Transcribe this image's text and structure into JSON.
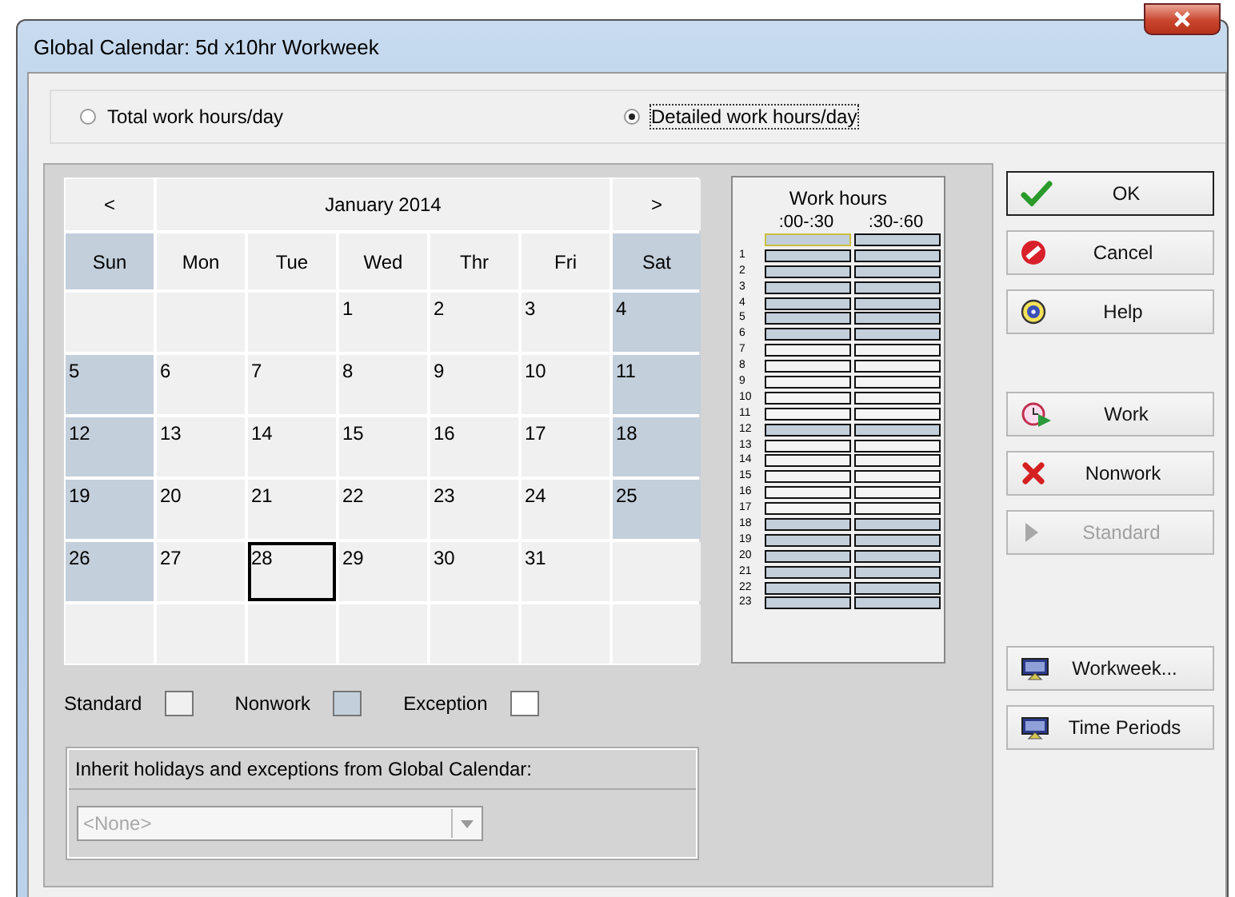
{
  "window": {
    "title": "Global Calendar: 5d x10hr Workweek"
  },
  "modes": [
    {
      "label": "Total work hours/day",
      "selected": false
    },
    {
      "label": "Detailed work hours/day",
      "selected": true
    }
  ],
  "calendar": {
    "prev": "<",
    "month": "January 2014",
    "next": ">",
    "weekdays": [
      {
        "label": "Sun",
        "nonwork": true
      },
      {
        "label": "Mon",
        "nonwork": false
      },
      {
        "label": "Tue",
        "nonwork": false
      },
      {
        "label": "Wed",
        "nonwork": false
      },
      {
        "label": "Thr",
        "nonwork": false
      },
      {
        "label": "Fri",
        "nonwork": false
      },
      {
        "label": "Sat",
        "nonwork": true
      }
    ],
    "weeks": [
      [
        {
          "kind": "blank"
        },
        {
          "kind": "blank"
        },
        {
          "kind": "blank"
        },
        {
          "kind": "day",
          "day": "1",
          "nonwork": false,
          "selected": false
        },
        {
          "kind": "day",
          "day": "2",
          "nonwork": false,
          "selected": false
        },
        {
          "kind": "day",
          "day": "3",
          "nonwork": false,
          "selected": false
        },
        {
          "kind": "day",
          "day": "4",
          "nonwork": true,
          "selected": false
        }
      ],
      [
        {
          "kind": "day",
          "day": "5",
          "nonwork": true,
          "selected": false
        },
        {
          "kind": "day",
          "day": "6",
          "nonwork": false,
          "selected": false
        },
        {
          "kind": "day",
          "day": "7",
          "nonwork": false,
          "selected": false
        },
        {
          "kind": "day",
          "day": "8",
          "nonwork": false,
          "selected": false
        },
        {
          "kind": "day",
          "day": "9",
          "nonwork": false,
          "selected": false
        },
        {
          "kind": "day",
          "day": "10",
          "nonwork": false,
          "selected": false
        },
        {
          "kind": "day",
          "day": "11",
          "nonwork": true,
          "selected": false
        }
      ],
      [
        {
          "kind": "day",
          "day": "12",
          "nonwork": true,
          "selected": false
        },
        {
          "kind": "day",
          "day": "13",
          "nonwork": false,
          "selected": false
        },
        {
          "kind": "day",
          "day": "14",
          "nonwork": false,
          "selected": false
        },
        {
          "kind": "day",
          "day": "15",
          "nonwork": false,
          "selected": false
        },
        {
          "kind": "day",
          "day": "16",
          "nonwork": false,
          "selected": false
        },
        {
          "kind": "day",
          "day": "17",
          "nonwork": false,
          "selected": false
        },
        {
          "kind": "day",
          "day": "18",
          "nonwork": true,
          "selected": false
        }
      ],
      [
        {
          "kind": "day",
          "day": "19",
          "nonwork": true,
          "selected": false
        },
        {
          "kind": "day",
          "day": "20",
          "nonwork": false,
          "selected": false
        },
        {
          "kind": "day",
          "day": "21",
          "nonwork": false,
          "selected": false
        },
        {
          "kind": "day",
          "day": "22",
          "nonwork": false,
          "selected": false
        },
        {
          "kind": "day",
          "day": "23",
          "nonwork": false,
          "selected": false
        },
        {
          "kind": "day",
          "day": "24",
          "nonwork": false,
          "selected": false
        },
        {
          "kind": "day",
          "day": "25",
          "nonwork": true,
          "selected": false
        }
      ],
      [
        {
          "kind": "day",
          "day": "26",
          "nonwork": true,
          "selected": false
        },
        {
          "kind": "day",
          "day": "27",
          "nonwork": false,
          "selected": false
        },
        {
          "kind": "day",
          "day": "28",
          "nonwork": false,
          "selected": true
        },
        {
          "kind": "day",
          "day": "29",
          "nonwork": false,
          "selected": false
        },
        {
          "kind": "day",
          "day": "30",
          "nonwork": false,
          "selected": false
        },
        {
          "kind": "day",
          "day": "31",
          "nonwork": false,
          "selected": false
        },
        {
          "kind": "blank"
        }
      ],
      [
        {
          "kind": "blank"
        },
        {
          "kind": "blank"
        },
        {
          "kind": "blank"
        },
        {
          "kind": "blank"
        },
        {
          "kind": "blank"
        },
        {
          "kind": "blank"
        },
        {
          "kind": "blank"
        }
      ]
    ]
  },
  "work_hours": {
    "title": "Work hours",
    "columns": [
      ":00-:30",
      ":30-:60"
    ],
    "rows": [
      {
        "slots": [
          {
            "work": false,
            "selected": true
          },
          {
            "work": false,
            "selected": false
          }
        ]
      },
      {
        "hour": "1",
        "slots": [
          {
            "work": false,
            "selected": false
          },
          {
            "work": false,
            "selected": false
          }
        ]
      },
      {
        "hour": "2",
        "slots": [
          {
            "work": false,
            "selected": false
          },
          {
            "work": false,
            "selected": false
          }
        ]
      },
      {
        "hour": "3",
        "slots": [
          {
            "work": false,
            "selected": false
          },
          {
            "work": false,
            "selected": false
          }
        ]
      },
      {
        "hour": "4",
        "slots": [
          {
            "work": false,
            "selected": false
          },
          {
            "work": false,
            "selected": false
          }
        ]
      },
      {
        "hour": "5",
        "slots": [
          {
            "work": false,
            "selected": false
          },
          {
            "work": false,
            "selected": false
          }
        ]
      },
      {
        "hour": "6",
        "slots": [
          {
            "work": false,
            "selected": false
          },
          {
            "work": false,
            "selected": false
          }
        ]
      },
      {
        "hour": "7",
        "slots": [
          {
            "work": true,
            "selected": false
          },
          {
            "work": true,
            "selected": false
          }
        ]
      },
      {
        "hour": "8",
        "slots": [
          {
            "work": true,
            "selected": false
          },
          {
            "work": true,
            "selected": false
          }
        ]
      },
      {
        "hour": "9",
        "slots": [
          {
            "work": true,
            "selected": false
          },
          {
            "work": true,
            "selected": false
          }
        ]
      },
      {
        "hour": "10",
        "slots": [
          {
            "work": true,
            "selected": false
          },
          {
            "work": true,
            "selected": false
          }
        ]
      },
      {
        "hour": "11",
        "slots": [
          {
            "work": true,
            "selected": false
          },
          {
            "work": true,
            "selected": false
          }
        ]
      },
      {
        "hour": "12",
        "slots": [
          {
            "work": false,
            "selected": false
          },
          {
            "work": false,
            "selected": false
          }
        ]
      },
      {
        "hour": "13",
        "slots": [
          {
            "work": true,
            "selected": false
          },
          {
            "work": true,
            "selected": false
          }
        ]
      },
      {
        "hour": "14",
        "slots": [
          {
            "work": true,
            "selected": false
          },
          {
            "work": true,
            "selected": false
          }
        ]
      },
      {
        "hour": "15",
        "slots": [
          {
            "work": true,
            "selected": false
          },
          {
            "work": true,
            "selected": false
          }
        ]
      },
      {
        "hour": "16",
        "slots": [
          {
            "work": true,
            "selected": false
          },
          {
            "work": true,
            "selected": false
          }
        ]
      },
      {
        "hour": "17",
        "slots": [
          {
            "work": true,
            "selected": false
          },
          {
            "work": true,
            "selected": false
          }
        ]
      },
      {
        "hour": "18",
        "slots": [
          {
            "work": false,
            "selected": false
          },
          {
            "work": false,
            "selected": false
          }
        ]
      },
      {
        "hour": "19",
        "slots": [
          {
            "work": false,
            "selected": false
          },
          {
            "work": false,
            "selected": false
          }
        ]
      },
      {
        "hour": "20",
        "slots": [
          {
            "work": false,
            "selected": false
          },
          {
            "work": false,
            "selected": false
          }
        ]
      },
      {
        "hour": "21",
        "slots": [
          {
            "work": false,
            "selected": false
          },
          {
            "work": false,
            "selected": false
          }
        ]
      },
      {
        "hour": "22",
        "slots": [
          {
            "work": false,
            "selected": false
          },
          {
            "work": false,
            "selected": false
          }
        ]
      },
      {
        "hour": "23",
        "slots": [
          {
            "work": false,
            "selected": false
          },
          {
            "work": false,
            "selected": false
          }
        ]
      }
    ]
  },
  "legend": [
    {
      "label": "Standard",
      "kind": "standard"
    },
    {
      "label": "Nonwork",
      "kind": "nonwork"
    },
    {
      "label": "Exception",
      "kind": "exception"
    }
  ],
  "inherit": {
    "label": "Inherit holidays and exceptions from Global Calendar:",
    "value": "<None>",
    "disabled": true
  },
  "button_groups": [
    [
      {
        "label": "OK",
        "kind": "check",
        "disabled": false,
        "default": true
      },
      {
        "label": "Cancel",
        "kind": "cancel",
        "disabled": false,
        "default": false
      },
      {
        "label": "Help",
        "kind": "help",
        "disabled": false,
        "default": false
      }
    ],
    [
      {
        "label": "Work",
        "kind": "work",
        "disabled": false,
        "default": false
      },
      {
        "label": "Nonwork",
        "kind": "nonwork",
        "disabled": false,
        "default": false
      },
      {
        "label": "Standard",
        "kind": "standard",
        "disabled": true,
        "default": false
      }
    ],
    [
      {
        "label": "Workweek...",
        "kind": "workweek",
        "disabled": false,
        "default": false
      },
      {
        "label": "Time Periods",
        "kind": "periods",
        "disabled": false,
        "default": false
      }
    ]
  ]
}
